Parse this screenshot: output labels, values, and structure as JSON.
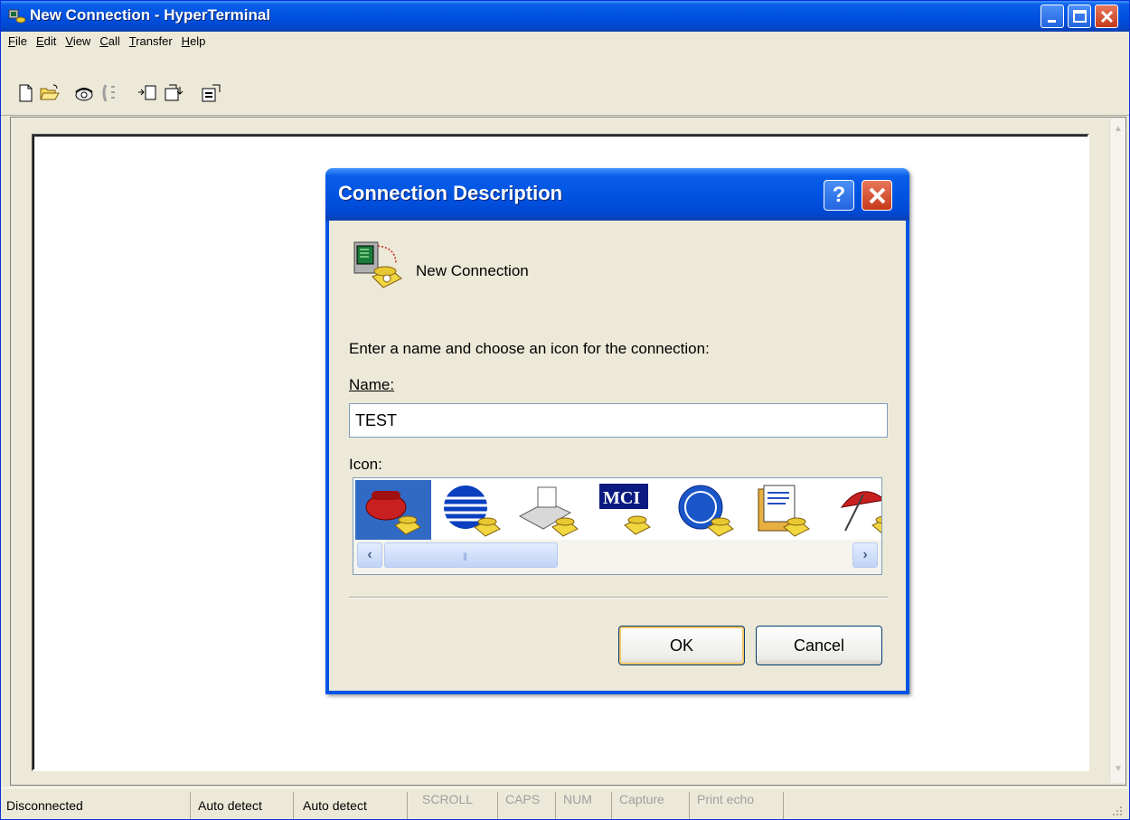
{
  "window": {
    "title": "New Connection - HyperTerminal"
  },
  "menu": [
    {
      "label": "File",
      "hotkey": "F"
    },
    {
      "label": "Edit",
      "hotkey": "E"
    },
    {
      "label": "View",
      "hotkey": "V"
    },
    {
      "label": "Call",
      "hotkey": "C"
    },
    {
      "label": "Transfer",
      "hotkey": "T"
    },
    {
      "label": "Help",
      "hotkey": "H"
    }
  ],
  "toolbar": {
    "icons": [
      "new-icon",
      "open-icon",
      "dial-icon",
      "disconnect-icon",
      "send-icon",
      "receive-icon",
      "properties-icon"
    ]
  },
  "dialog": {
    "title": "Connection Description",
    "connection_label": "New Connection",
    "prompt": "Enter a name and choose an icon for the connection:",
    "name_label": "Name:",
    "name_value": "TEST",
    "icon_label": "Icon:",
    "icons": [
      "red-phone-icon",
      "globe-phone-icon",
      "fax-phone-icon",
      "mci-phone-icon",
      "ge-phone-icon",
      "document-phone-icon",
      "umbrella-phone-icon"
    ],
    "ok_label": "OK",
    "cancel_label": "Cancel",
    "help_label": "?",
    "colors": {
      "selected": "#316ac5",
      "title": "#0054e3"
    }
  },
  "status": {
    "connection": "Disconnected",
    "emulation": "Auto detect",
    "settings": "Auto detect",
    "scroll": "SCROLL",
    "caps": "CAPS",
    "num": "NUM",
    "capture": "Capture",
    "print_echo": "Print echo"
  }
}
